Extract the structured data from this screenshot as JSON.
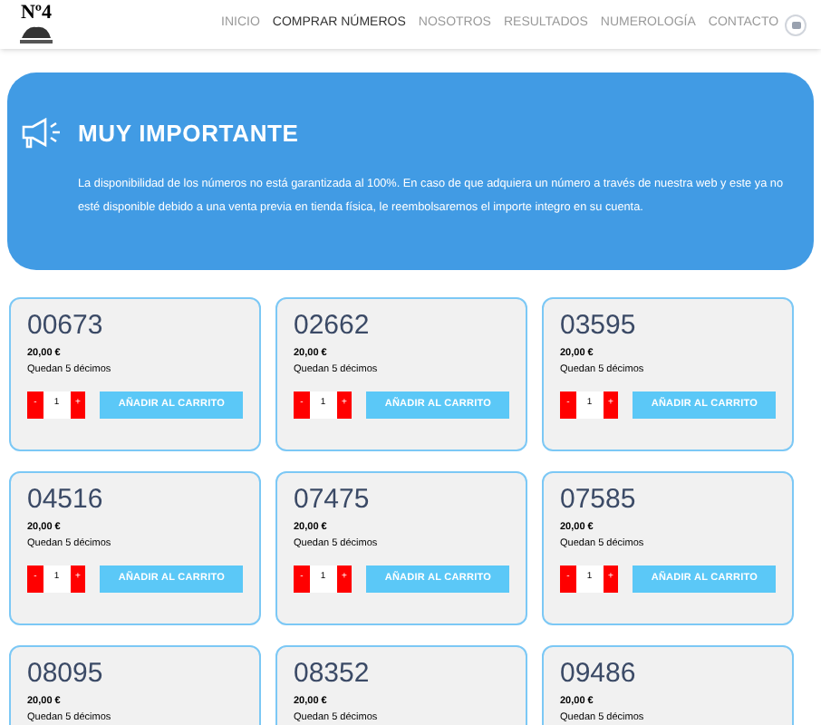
{
  "header": {
    "logo_text": "Nº4",
    "nav": [
      {
        "label": "INICIO",
        "selected": false
      },
      {
        "label": "COMPRAR NÚMEROS",
        "selected": true
      },
      {
        "label": "NOSOTROS",
        "selected": false
      },
      {
        "label": "RESULTADOS",
        "selected": false
      },
      {
        "label": "NUMEROLOGÍA",
        "selected": false
      },
      {
        "label": "CONTACTO",
        "selected": false
      }
    ]
  },
  "notice": {
    "title": "MUY IMPORTANTE",
    "text": "La disponibilidad de los números no está garantizada al 100%. En caso de que adquiera un número a través de nuestra web y este ya no esté disponible debido a una venta previa en tienda física, le reembolsaremos el importe integro en su cuenta."
  },
  "products": [
    {
      "number": "00673",
      "price": "20,00 €",
      "stock": "Quedan 5 décimos",
      "minus": "-",
      "quantity": "1",
      "plus": "+",
      "button": "AÑADIR AL CARRITO"
    },
    {
      "number": "02662",
      "price": "20,00 €",
      "stock": "Quedan 5 décimos",
      "minus": "-",
      "quantity": "1",
      "plus": "+",
      "button": "AÑADIR AL CARRITO"
    },
    {
      "number": "03595",
      "price": "20,00 €",
      "stock": "Quedan 5 décimos",
      "minus": "-",
      "quantity": "1",
      "plus": "+",
      "button": "AÑADIR AL CARRITO"
    },
    {
      "number": "04516",
      "price": "20,00 €",
      "stock": "Quedan 5 décimos",
      "minus": "-",
      "quantity": "1",
      "plus": "+",
      "button": "AÑADIR AL CARRITO"
    },
    {
      "number": "07475",
      "price": "20,00 €",
      "stock": "Quedan 5 décimos",
      "minus": "-",
      "quantity": "1",
      "plus": "+",
      "button": "AÑADIR AL CARRITO"
    },
    {
      "number": "07585",
      "price": "20,00 €",
      "stock": "Quedan 5 décimos",
      "minus": "-",
      "quantity": "1",
      "plus": "+",
      "button": "AÑADIR AL CARRITO"
    },
    {
      "number": "08095",
      "price": "20,00 €",
      "stock": "Quedan 5 décimos"
    },
    {
      "number": "08352",
      "price": "20,00 €",
      "stock": "Quedan 5 décimos"
    },
    {
      "number": "09486",
      "price": "20,00 €",
      "stock": "Quedan 5 décimos"
    }
  ]
}
